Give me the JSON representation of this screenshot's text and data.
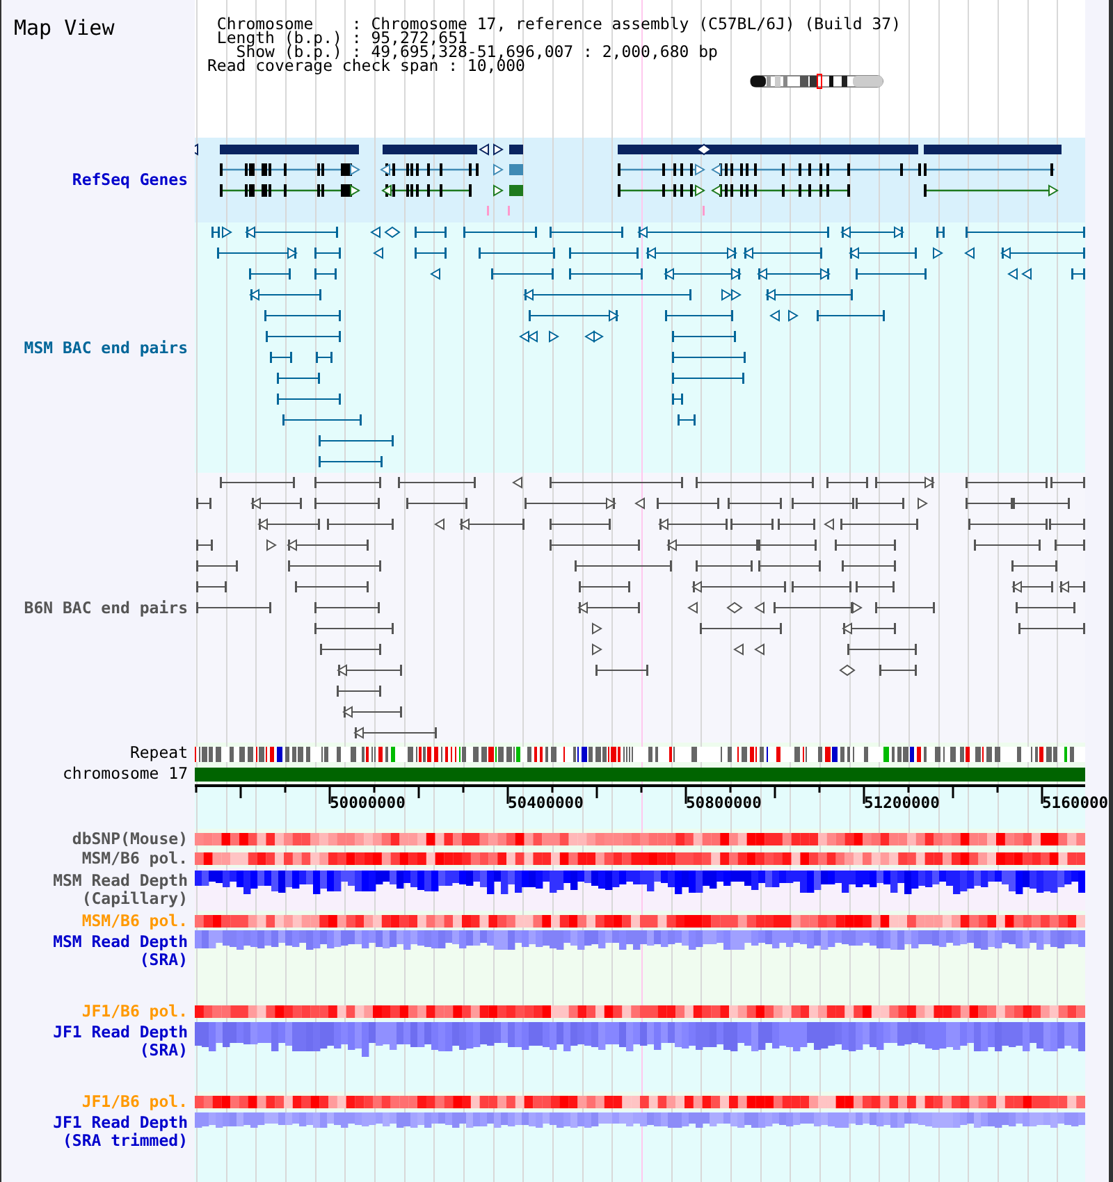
{
  "title": "Map View",
  "info_lines": [
    " Chromosome    : Chromosome 17, reference assembly (C57BL/6J) (Build 37)",
    " Length (b.p.) : 95,272,651",
    "   Show (b.p.) : 49,695,328-51,696,007 : 2,000,680 bp",
    "Read coverage check span : 10,000"
  ],
  "tracks": [
    {
      "kind": "genes",
      "label": [
        "RefSeq Genes"
      ],
      "color": "#0000cc"
    },
    {
      "kind": "bacpairs",
      "label": [
        "MSM BAC end pairs"
      ],
      "color": "#006699"
    },
    {
      "kind": "bacpairs",
      "label": [
        "B6N BAC end pairs"
      ],
      "color": "#555555"
    },
    {
      "kind": "repeat",
      "label": [
        "Repeat"
      ],
      "color": "#000000"
    },
    {
      "kind": "chromosome",
      "label": [
        "chromosome 17"
      ],
      "color": "#000000"
    },
    {
      "kind": "ruler",
      "ticks": [
        "50000000",
        "50400000",
        "50800000",
        "51200000",
        "5160000"
      ]
    },
    {
      "kind": "heatmap",
      "label": [
        "dbSNP(Mouse)"
      ],
      "color": "#555555"
    },
    {
      "kind": "heatmap",
      "label": [
        "MSM/B6 pol."
      ],
      "color": "#555555"
    },
    {
      "kind": "capillary",
      "label": [
        "MSM Read Depth",
        "(Capillary)"
      ],
      "color": "#555555"
    },
    {
      "kind": "heatmap",
      "label": [
        "MSM/B6 pol."
      ],
      "color": "#ff9900"
    },
    {
      "kind": "sra",
      "label": [
        "MSM Read Depth",
        "(SRA)"
      ],
      "color": "#0000cc"
    },
    {
      "kind": "heatmap",
      "label": [
        "JF1/B6 pol."
      ],
      "color": "#ff9900"
    },
    {
      "kind": "sra",
      "label": [
        "JF1 Read Depth",
        "(SRA)"
      ],
      "color": "#0000cc"
    },
    {
      "kind": "heatmap",
      "label": [
        "JF1/B6 pol."
      ],
      "color": "#ff9900"
    },
    {
      "kind": "sra",
      "label": [
        "JF1 Read Depth",
        "(SRA trimmed)"
      ],
      "color": "#0000cc"
    }
  ]
}
